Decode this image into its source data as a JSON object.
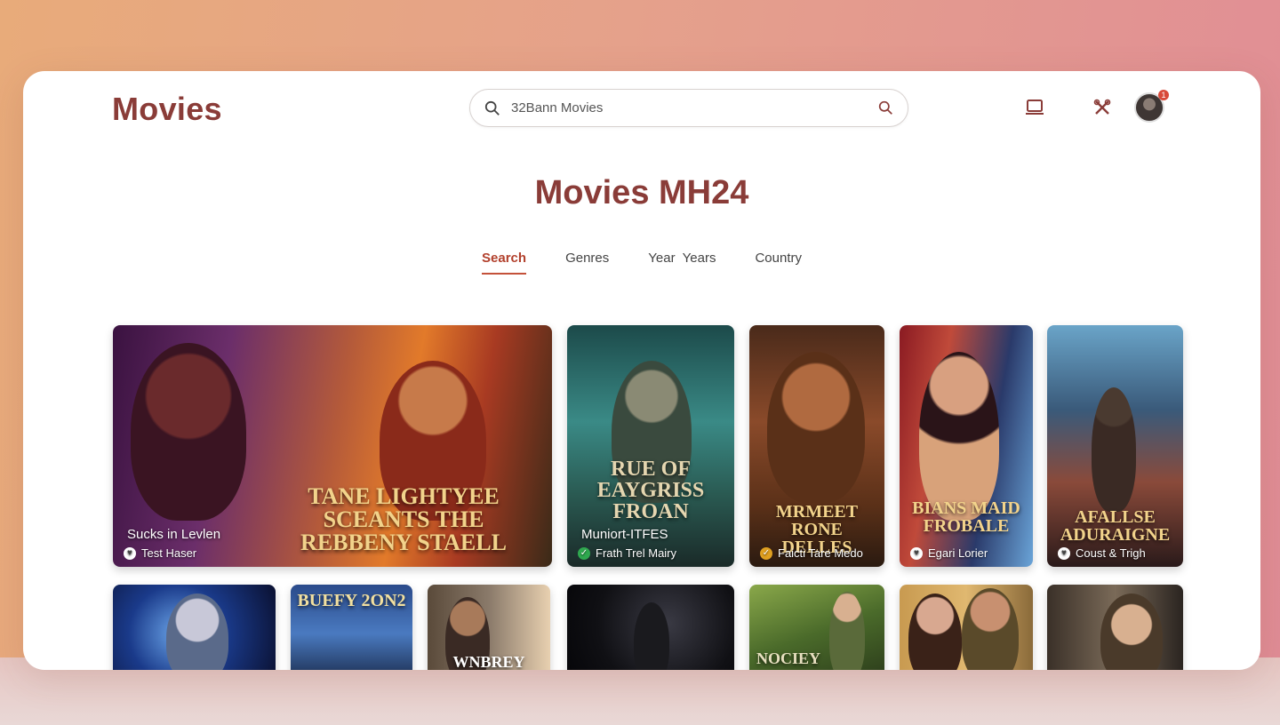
{
  "app": {
    "brand": "Movies",
    "page_title": "Movies MH24"
  },
  "search": {
    "placeholder": "32Bann Movies"
  },
  "header_icons": [
    "laptop-icon",
    "tools-icon"
  ],
  "notifications": {
    "count": "1"
  },
  "tabs": [
    {
      "label": "Search",
      "active": true
    },
    {
      "label": "Genres",
      "active": false
    },
    {
      "label": "Year  Years",
      "active": false
    },
    {
      "label": "Country",
      "active": false
    }
  ],
  "featured": [
    {
      "title": "TANE LIGHTYEE SCEANTS  THE REBBENY STAELL",
      "subtitle": "Sucks in Levlen",
      "caption": "Test Haser",
      "check": "heart"
    },
    {
      "title": "RUE OF EAYGRISS FROAN",
      "subtitle": "Muniort-ITFES",
      "caption": "Frath Trel Mairy",
      "check": "check"
    },
    {
      "title": "MRMEET RONE DELLES",
      "subtitle": "",
      "caption": "Faicti Tare Medo",
      "check": "check"
    },
    {
      "title": "BIANS MAID FROBALE",
      "subtitle": "",
      "caption": "Egari Lorier",
      "check": "heart"
    },
    {
      "title": "AFALLSE ADURAIGNE",
      "subtitle": "",
      "caption": "Coust & Trigh",
      "check": "heart"
    }
  ],
  "second_row": [
    {
      "title": ""
    },
    {
      "title": "BUEFY 2ON2"
    },
    {
      "title": "WNBREY"
    },
    {
      "title": ""
    },
    {
      "title": "NOCIEY"
    },
    {
      "title": ""
    },
    {
      "title": ""
    }
  ],
  "colors": {
    "brand": "#8a3c38",
    "accent": "#c4513a"
  }
}
